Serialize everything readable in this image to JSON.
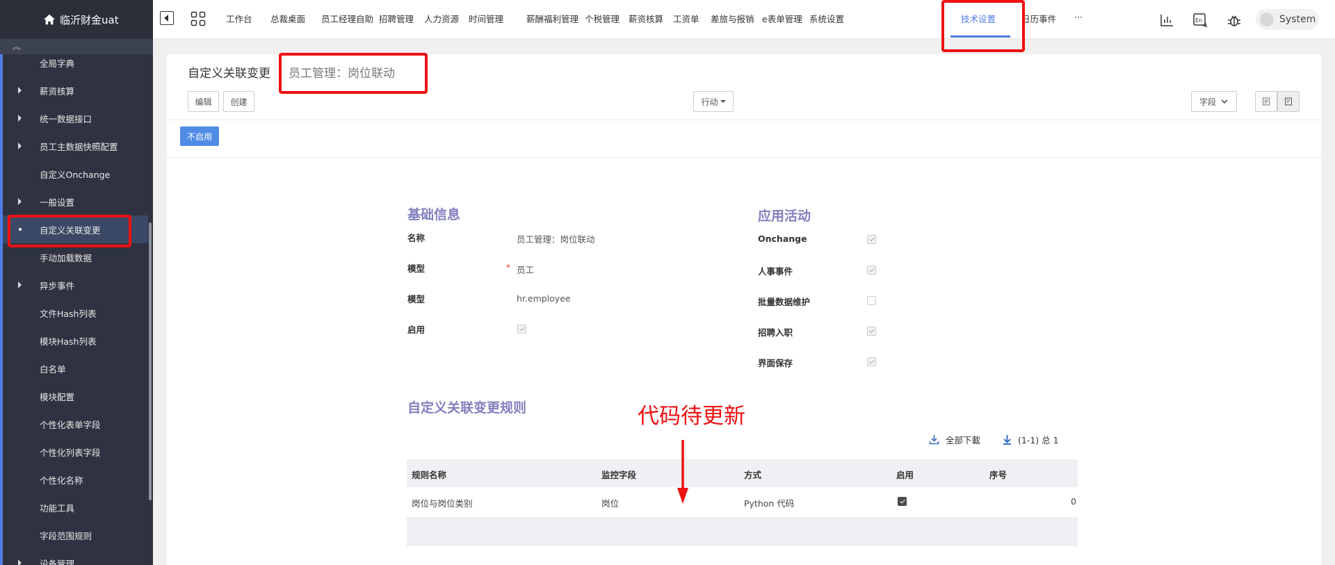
{
  "app": {
    "title": "临沂财金uat"
  },
  "sidebar": {
    "collapse_glyph": "︽",
    "items": [
      {
        "label": "全局字典",
        "arrow": false
      },
      {
        "label": "薪资核算",
        "arrow": true
      },
      {
        "label": "统一数据接口",
        "arrow": true
      },
      {
        "label": "员工主数据快照配置",
        "arrow": true
      },
      {
        "label": "自定义Onchange",
        "arrow": false
      },
      {
        "label": "一般设置",
        "arrow": true
      },
      {
        "label": "自定义关联变更",
        "active": true
      },
      {
        "label": "手动加载数据",
        "arrow": false
      },
      {
        "label": "异步事件",
        "arrow": true
      },
      {
        "label": "文件Hash列表",
        "arrow": false
      },
      {
        "label": "模块Hash列表",
        "arrow": false
      },
      {
        "label": "白名单",
        "arrow": false
      },
      {
        "label": "模块配置",
        "arrow": false
      },
      {
        "label": "个性化表单字段",
        "arrow": false
      },
      {
        "label": "个性化列表字段",
        "arrow": false
      },
      {
        "label": "个性化名称",
        "arrow": false
      },
      {
        "label": "功能工具",
        "arrow": false
      },
      {
        "label": "字段范围规则",
        "arrow": false
      },
      {
        "label": "设备管理",
        "arrow": true
      }
    ]
  },
  "topbar": {
    "menu": [
      "工作台",
      "总裁桌面",
      "员工经理自助",
      "招聘管理",
      "人力资源",
      "时间管理",
      "薪酬福利管理",
      "个税管理",
      "薪资核算",
      "工资单",
      "差旅与报销",
      "e表单管理",
      "系统设置",
      "技术设置",
      "日历事件",
      "···"
    ],
    "active_menu": "技术设置",
    "icons": [
      "chart-icon",
      "language-icon",
      "bug-icon"
    ],
    "user": "System"
  },
  "page": {
    "breadcrumb_main": "自定义关联变更",
    "breadcrumb_sep": "/",
    "record_name": "员工管理：岗位联动",
    "edit_label": "编辑",
    "create_label": "创建",
    "action_label": "行动",
    "fields_label": "字段",
    "status_label": "不启用"
  },
  "form": {
    "basic_title": "基础信息",
    "activity_title": "应用活动",
    "name_label": "名称",
    "name_value": "员工管理：岗位联动",
    "model_label": "模型",
    "model_value": "员工",
    "model2_label": "模型",
    "model2_value": "hr.employee",
    "enabled_label": "启用",
    "required_mark": "*",
    "activities": [
      {
        "label": "Onchange",
        "checked": true
      },
      {
        "label": "人事事件",
        "checked": true
      },
      {
        "label": "批量数据维护",
        "checked": false
      },
      {
        "label": "招聘入职",
        "checked": true
      },
      {
        "label": "界面保存",
        "checked": true
      }
    ]
  },
  "rules": {
    "title": "自定义关联变更规则",
    "download_label": "全部下載",
    "pager_label": "(1-1) 总 1",
    "columns": [
      "规则名称",
      "监控字段",
      "方式",
      "启用",
      "序号"
    ],
    "rows": [
      {
        "name": "岗位与岗位类别",
        "field": "岗位",
        "method": "Python 代码",
        "enabled": true,
        "seq": "0"
      }
    ]
  },
  "annotation": {
    "text": "代码待更新",
    "color": "#ee1111"
  }
}
